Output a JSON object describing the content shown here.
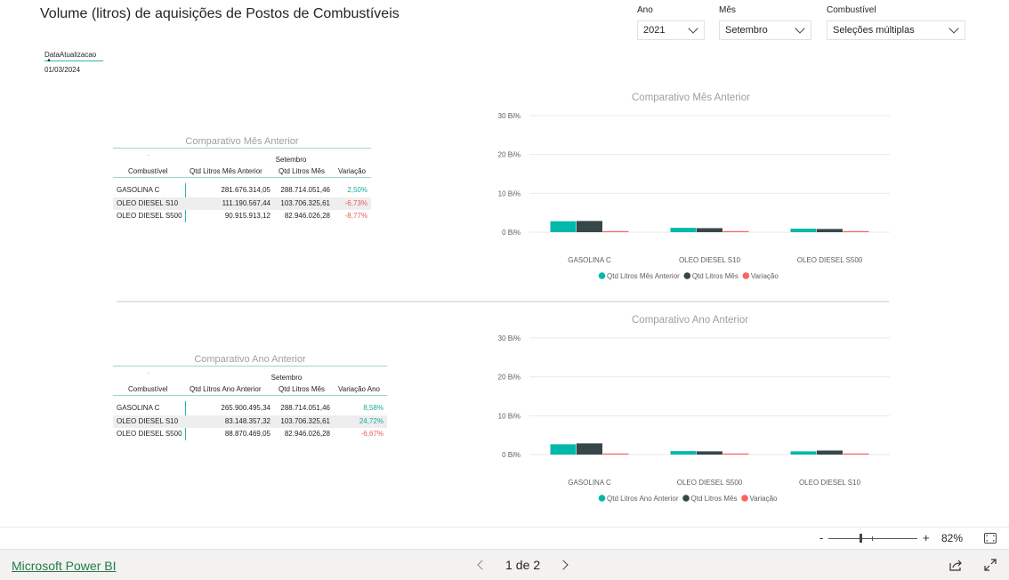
{
  "report": {
    "title": "Volume (litros) de aquisições de Postos de Combustíveis"
  },
  "slicers": {
    "ano": {
      "label": "Ano",
      "value": "2021"
    },
    "mes": {
      "label": "Mês",
      "value": "Setembro"
    },
    "combustivel": {
      "label": "Combustível",
      "value": "Seleções múltiplas"
    }
  },
  "data_card": {
    "label": "DataAtualizacao",
    "value": "01/03/2024"
  },
  "table_mes": {
    "title": "Comparativo Mês Anterior",
    "sort_glyph": ".",
    "group": "Setembro",
    "headers": [
      "Combustível",
      "Qtd Litros Mês Anterior",
      "Qtd Litros Mês",
      "Variação"
    ],
    "rows": [
      [
        "GASOLINA C",
        "281.676.314,05",
        "288.714.051,46",
        "2,50%"
      ],
      [
        "OLEO DIESEL S10",
        "111.190.567,44",
        "103.706.325,61",
        "-6,73%"
      ],
      [
        "OLEO DIESEL S500",
        "90.915.913,12",
        "82.946.026,28",
        "-8,77%"
      ]
    ]
  },
  "table_ano": {
    "title": "Comparativo Ano Anterior",
    "sort_glyph": ".",
    "group": "Setembro",
    "headers": [
      "Combustível",
      "Qtd Litros Ano Anterior",
      "Qtd Litros Mês",
      "Variação Ano"
    ],
    "rows": [
      [
        "GASOLINA C",
        "265.900.495,34",
        "288.714.051,46",
        "8,58%"
      ],
      [
        "OLEO DIESEL S10",
        "83.148.357,32",
        "103.706.325,61",
        "24,72%"
      ],
      [
        "OLEO DIESEL S500",
        "88.870.469,05",
        "82.946.026,28",
        "-6,67%"
      ]
    ]
  },
  "chart_data": [
    {
      "type": "bar",
      "title": "Comparativo Mês Anterior",
      "categories": [
        "GASOLINA C",
        "OLEO DIESEL S10",
        "OLEO DIESEL S500"
      ],
      "series": [
        {
          "name": "Qtd Litros Mês Anterior",
          "values": [
            281676314.05,
            111190567.44,
            90915913.12
          ],
          "color": "#01b8aa"
        },
        {
          "name": "Qtd Litros Mês",
          "values": [
            288714051.46,
            103706325.61,
            82946026.28
          ],
          "color": "#374649"
        },
        {
          "name": "Variação",
          "values": [
            0.025,
            -0.0673,
            -0.0877
          ],
          "color": "#fd625e"
        }
      ],
      "yticks": [
        "0 Bi%",
        "10 Bi%",
        "20 Bi%",
        "30 Bi%"
      ],
      "ylim": [
        0,
        3000000000
      ],
      "xlabel": "",
      "ylabel": "",
      "grid": true,
      "legend": "bottom-center"
    },
    {
      "type": "bar",
      "title": "Comparativo Ano Anterior",
      "categories": [
        "GASOLINA C",
        "OLEO DIESEL S500",
        "OLEO DIESEL S10"
      ],
      "series": [
        {
          "name": "Qtd Litros Ano Anterior",
          "values": [
            265900495.34,
            88870469.05,
            83148357.32
          ],
          "color": "#01b8aa"
        },
        {
          "name": "Qtd Litros Mês",
          "values": [
            288714051.46,
            82946026.28,
            103706325.61
          ],
          "color": "#374649"
        },
        {
          "name": "Variação",
          "values": [
            0.0858,
            -0.0667,
            0.2472
          ],
          "color": "#fd625e"
        }
      ],
      "yticks": [
        "0 Bi%",
        "10 Bi%",
        "20 Bi%",
        "30 Bi%"
      ],
      "ylim": [
        0,
        3000000000
      ],
      "xlabel": "",
      "ylabel": "",
      "grid": true,
      "legend": "bottom-center"
    }
  ],
  "zoom": {
    "minus": "-",
    "plus": "+",
    "level_label": "82%",
    "level": 0.82
  },
  "footer": {
    "link": "Microsoft Power BI",
    "page_current": "1",
    "page_sep": "de",
    "page_total": "2"
  },
  "colors": {
    "teal": "#01b8aa",
    "dark": "#374649",
    "red": "#fd625e",
    "positive_text": "#1aab9b",
    "negative_text": "#e85c5c"
  }
}
